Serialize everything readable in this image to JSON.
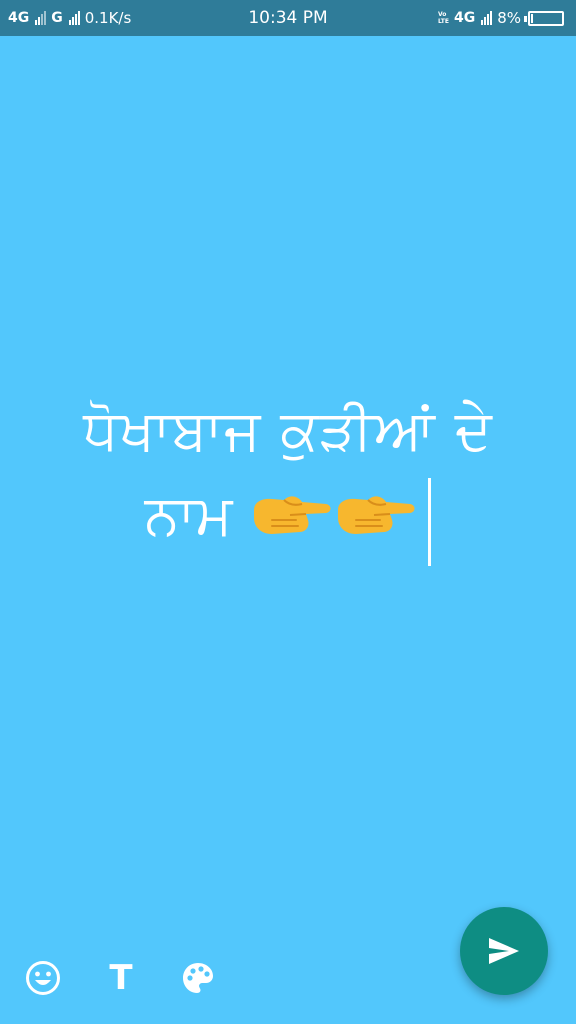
{
  "status_bar": {
    "left_network_1": "4G",
    "left_network_2": "G",
    "speed": "0.1K/s",
    "time": "10:34 PM",
    "volte_top": "Vo",
    "volte_bottom": "LTE",
    "right_network": "4G",
    "battery_percent": "8%",
    "battery_level": 0.08
  },
  "caption": {
    "line1": "ਧੋਖਾਬਾਜ ਕੁੜੀਆਂ ਦੇ",
    "line2_text": "ਨਾਮ",
    "emoji": "backhand-index-pointing-right-icon",
    "emoji_count": 2
  },
  "toolbar": {
    "emoji_icon": "smiley-icon",
    "text_label": "T",
    "palette_icon": "palette-icon",
    "send_icon": "send-icon"
  },
  "colors": {
    "background": "#52C7FC",
    "status_bar": "#2F7C99",
    "send_button": "#0E8D83",
    "text": "#FFFFFF"
  }
}
